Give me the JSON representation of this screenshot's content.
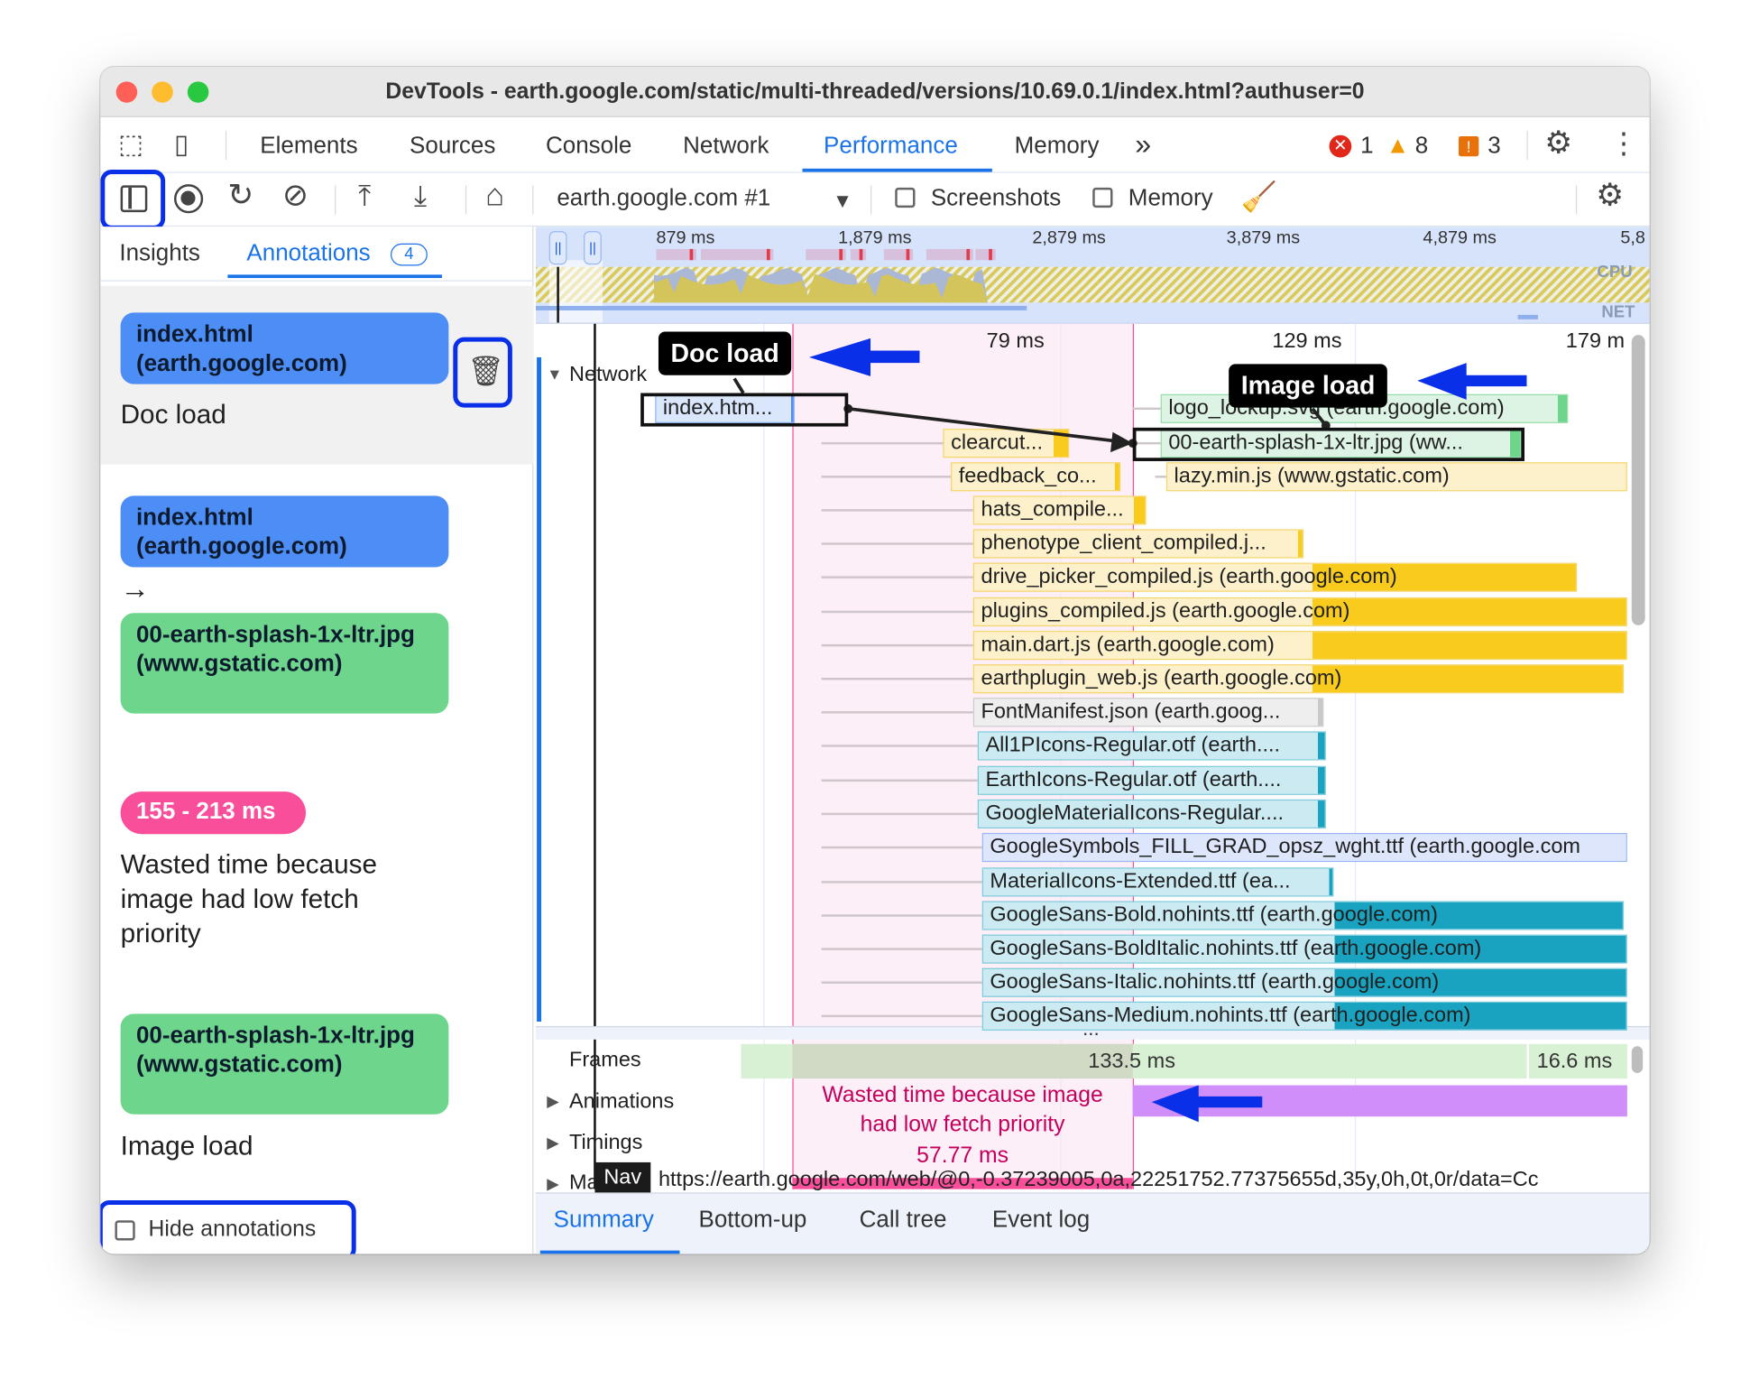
{
  "window": {
    "title": "DevTools - earth.google.com/static/multi-threaded/versions/10.69.0.1/index.html?authuser=0"
  },
  "tabs": [
    "Elements",
    "Sources",
    "Console",
    "Network",
    "Performance",
    "Memory"
  ],
  "active_tab": "Performance",
  "more_tabs": "»",
  "status": {
    "errors": "1",
    "warnings": "8",
    "issues": "3"
  },
  "toolbar": {
    "target": "earth.google.com #1",
    "screenshots": "Screenshots",
    "memory": "Memory",
    "screenshots_checked": false,
    "memory_checked": false
  },
  "sidebar": {
    "tabs": {
      "insights": "Insights",
      "annotations": "Annotations",
      "count": "4"
    },
    "annotations": [
      {
        "chip": "index.html (earth.google.com)",
        "label": "Doc load",
        "chip_color": "#4d8df6"
      },
      {
        "from": "index.html (earth.google.com)",
        "arrow": "→",
        "to": "00-earth-splash-1x-ltr.jpg (www.gstatic.com)"
      },
      {
        "chip": "155 - 213 ms",
        "label": "Wasted time because image had low fetch priority",
        "chip_color": "#f94f9b"
      },
      {
        "chip": "00-earth-splash-1x-ltr.jpg (www.gstatic.com)",
        "label": "Image load",
        "chip_color": "#6dd58c"
      }
    ],
    "hide_annotations": "Hide annotations",
    "hide_checked": false
  },
  "overview": {
    "ticks": [
      "879 ms",
      "1,879 ms",
      "2,879 ms",
      "3,879 ms",
      "4,879 ms",
      "5,8"
    ],
    "cpu": "CPU",
    "net": "NET"
  },
  "timeline": {
    "ticks": [
      "79 ms",
      "129 ms",
      "179 m"
    ],
    "network_label": "Network",
    "requests": [
      "index.htm...",
      "logo_lockup.svg (earth.google.com)",
      "clearcut...",
      "00-earth-splash-1x-ltr.jpg (ww...",
      "feedback_co...",
      "lazy.min.js (www.gstatic.com)",
      "hats_compile...",
      "phenotype_client_compiled.j...",
      "drive_picker_compiled.js (earth.google.com)",
      "plugins_compiled.js (earth.google.com)",
      "main.dart.js (earth.google.com)",
      "earthplugin_web.js (earth.google.com)",
      "FontManifest.json (earth.goog...",
      "All1PIcons-Regular.otf (earth....",
      "EarthIcons-Regular.otf (earth....",
      "GoogleMaterialIcons-Regular....",
      "GoogleSymbols_FILL_GRAD_opsz_wght.ttf (earth.google.com",
      "MaterialIcons-Extended.ttf (ea...",
      "GoogleSans-Bold.nohints.ttf (earth.google.com)",
      "GoogleSans-BoldItalic.nohints.ttf (earth.google.com)",
      "GoogleSans-Italic.nohints.ttf (earth.google.com)",
      "GoogleSans-Medium.nohints.ttf (earth.google.com)"
    ],
    "callouts": {
      "doc": "Doc load",
      "image": "Image load"
    },
    "wasted": {
      "line1": "Wasted time because image",
      "line2": "had low fetch priority",
      "duration": "57.77 ms"
    },
    "tracks": {
      "frames": "Frames",
      "animations": "Animations",
      "timings": "Timings",
      "main": "Ma",
      "nav": "Nav",
      "main_url": "https://earth.google.com/web/@0,-0.37239005,0a,22251752.77375655d,35y,0h,0t,0r/data=Cc"
    },
    "frames": {
      "f1": "133.5 ms",
      "f2": "16.6 ms"
    },
    "more": "..."
  },
  "bottom_tabs": [
    "Summary",
    "Bottom-up",
    "Call tree",
    "Event log"
  ],
  "colors": {
    "accent": "#1a73e8",
    "highlight": "#0a2fe8",
    "wasted": "#f94f9b",
    "script": "#f8cb1c",
    "image": "#6dd58c",
    "font": "#1aa3c0"
  }
}
